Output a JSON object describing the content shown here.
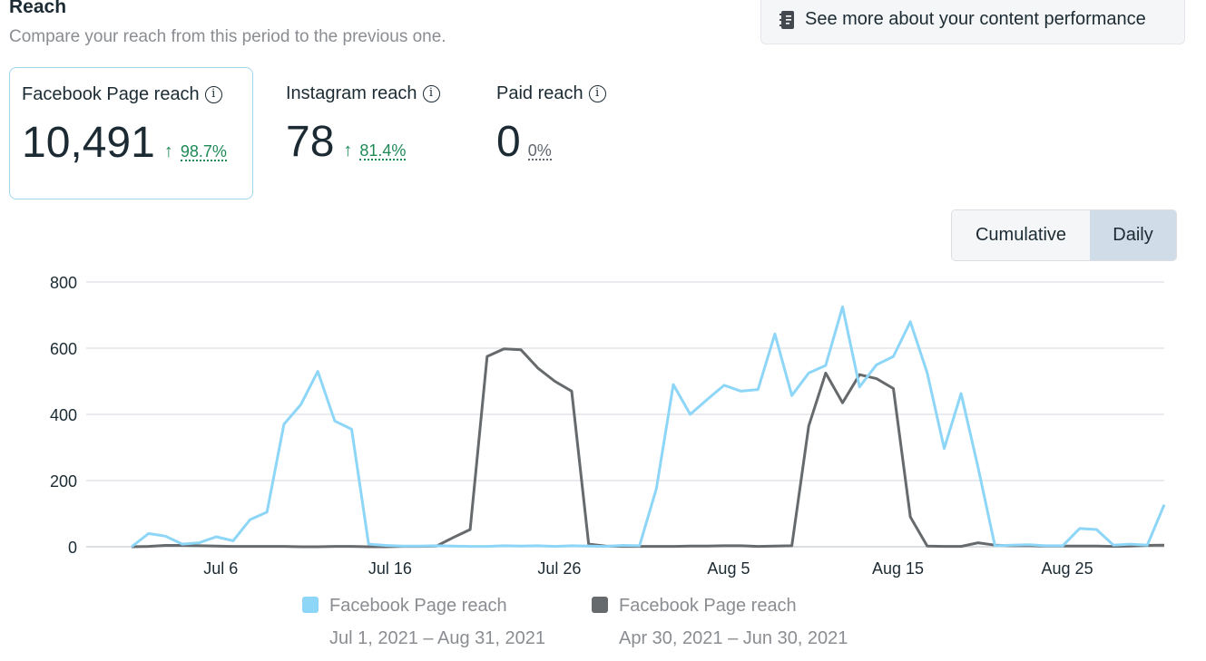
{
  "header": {
    "title": "Reach",
    "subtitle": "Compare your reach from this period to the previous one.",
    "performance_button": "See more about your content performance"
  },
  "metrics": [
    {
      "label": "Facebook Page reach",
      "value": "10,491",
      "arrow": "↑",
      "change": "98.7%"
    },
    {
      "label": "Instagram reach",
      "value": "78",
      "arrow": "↑",
      "change": "81.4%"
    },
    {
      "label": "Paid reach",
      "value": "0",
      "change": "0%"
    }
  ],
  "toggle": {
    "cumulative": "Cumulative",
    "daily": "Daily",
    "selected": "Daily"
  },
  "colors": {
    "current": "#8dd6f7",
    "previous": "#666a6c",
    "positive": "#1e8a56"
  },
  "chart_data": {
    "type": "line",
    "title": "",
    "xlabel": "",
    "ylabel": "",
    "ylim": [
      0,
      800
    ],
    "yticks": [
      "0",
      "200",
      "400",
      "600",
      "800"
    ],
    "ytick_values": [
      0,
      200,
      400,
      600,
      800
    ],
    "xticks": [
      "Jul 6",
      "Jul 16",
      "Jul 26",
      "Aug 5",
      "Aug 15",
      "Aug 25"
    ],
    "xtick_index": [
      5,
      15,
      25,
      35,
      45,
      55
    ],
    "grid": true,
    "legend_position": "bottom",
    "series": [
      {
        "name": "Facebook Page reach",
        "period": "Jul 1, 2021 – Aug 31, 2021",
        "values": [
          0,
          40,
          32,
          8,
          12,
          30,
          18,
          82,
          105,
          370,
          430,
          530,
          380,
          355,
          8,
          4,
          2,
          2,
          3,
          2,
          1,
          1,
          3,
          2,
          3,
          1,
          3,
          2,
          1,
          4,
          3,
          175,
          490,
          400,
          445,
          488,
          470,
          475,
          643,
          457,
          525,
          548,
          725,
          483,
          550,
          575,
          680,
          525,
          297,
          463,
          240,
          3,
          5,
          6,
          3,
          3,
          55,
          52,
          5,
          8,
          5,
          127
        ]
      },
      {
        "name": "Facebook Page reach",
        "period": "Apr 30, 2021 – Jun 30, 2021",
        "values": [
          0,
          1,
          4,
          4,
          3,
          2,
          1,
          1,
          1,
          1,
          0,
          0,
          1,
          1,
          0,
          0,
          1,
          1,
          2,
          28,
          52,
          575,
          598,
          595,
          540,
          500,
          470,
          8,
          2,
          1,
          1,
          1,
          1,
          2,
          2,
          3,
          3,
          1,
          2,
          3,
          365,
          525,
          435,
          520,
          508,
          478,
          90,
          2,
          1,
          1,
          12,
          5,
          3,
          3,
          2,
          2,
          2,
          2,
          1,
          2,
          4,
          5
        ]
      }
    ]
  }
}
